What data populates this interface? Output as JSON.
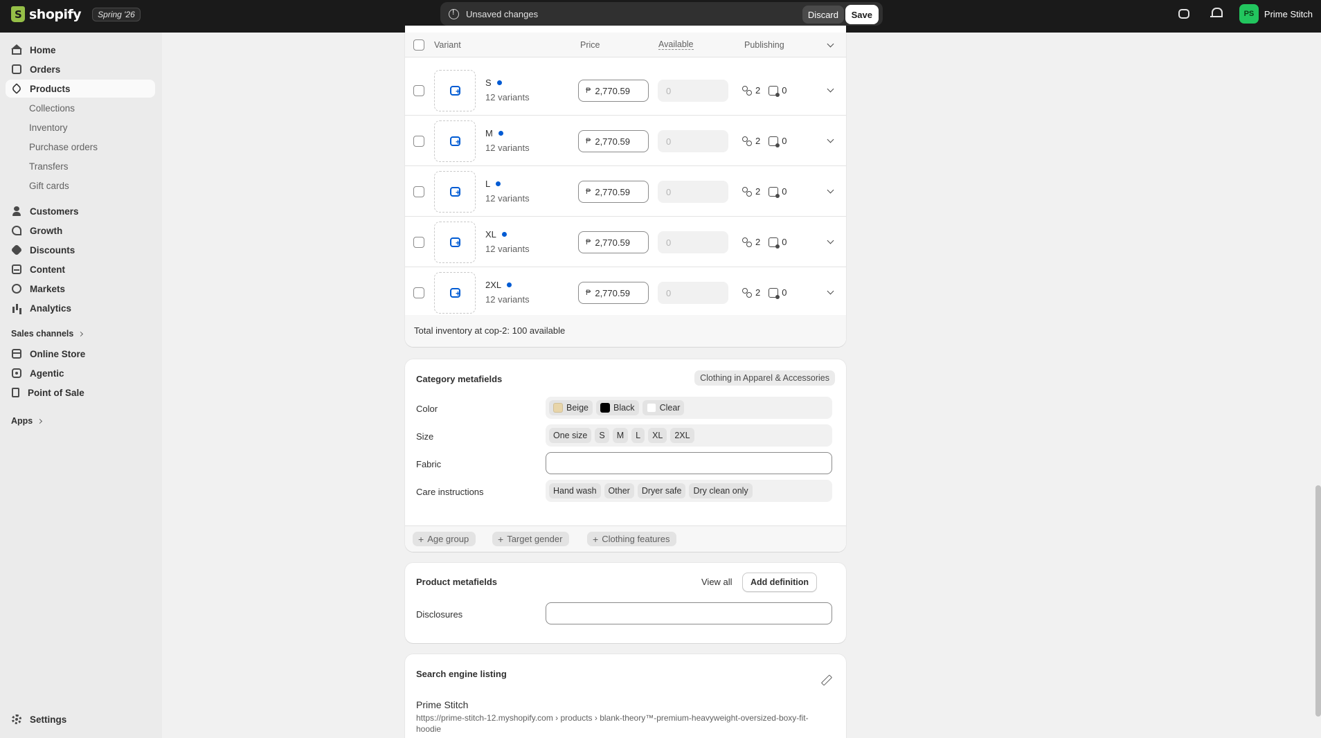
{
  "topbar": {
    "logo_text": "shopify",
    "edition": "Spring '26",
    "unsaved_message": "Unsaved changes",
    "discard_label": "Discard",
    "save_label": "Save",
    "avatar_initials": "PS",
    "store_name": "Prime Stitch"
  },
  "sidebar": {
    "home": "Home",
    "orders": "Orders",
    "products": "Products",
    "products_sub": [
      "Collections",
      "Inventory",
      "Purchase orders",
      "Transfers",
      "Gift cards"
    ],
    "customers": "Customers",
    "growth": "Growth",
    "discounts": "Discounts",
    "content": "Content",
    "markets": "Markets",
    "analytics": "Analytics",
    "sales_channels": "Sales channels",
    "online_store": "Online Store",
    "agentic": "Agentic",
    "point_of_sale": "Point of Sale",
    "apps": "Apps",
    "settings": "Settings"
  },
  "variants": {
    "headers": {
      "variant": "Variant",
      "price": "Price",
      "available": "Available",
      "publishing": "Publishing"
    },
    "currency_symbol": "₱",
    "rows": [
      {
        "name": "S",
        "count": "12 variants",
        "price": "2,770.59",
        "available": "0",
        "channels": "2",
        "markets": "0"
      },
      {
        "name": "M",
        "count": "12 variants",
        "price": "2,770.59",
        "available": "0",
        "channels": "2",
        "markets": "0"
      },
      {
        "name": "L",
        "count": "12 variants",
        "price": "2,770.59",
        "available": "0",
        "channels": "2",
        "markets": "0"
      },
      {
        "name": "XL",
        "count": "12 variants",
        "price": "2,770.59",
        "available": "0",
        "channels": "2",
        "markets": "0"
      },
      {
        "name": "2XL",
        "count": "12 variants",
        "price": "2,770.59",
        "available": "0",
        "channels": "2",
        "markets": "0"
      }
    ],
    "total_inventory": "Total inventory at cop-2: 100 available"
  },
  "category_metafields": {
    "title": "Category metafields",
    "category_badge": "Clothing in Apparel & Accessories",
    "color_label": "Color",
    "colors": [
      {
        "label": "Beige",
        "swatch": "#e8d5a9"
      },
      {
        "label": "Black",
        "swatch": "#000000"
      },
      {
        "label": "Clear",
        "swatch": "#ffffff"
      }
    ],
    "size_label": "Size",
    "sizes": [
      "One size",
      "S",
      "M",
      "L",
      "XL",
      "2XL"
    ],
    "fabric_label": "Fabric",
    "care_label": "Care instructions",
    "care": [
      "Hand wash",
      "Other",
      "Dryer safe",
      "Dry clean only"
    ],
    "add_fields": [
      "Age group",
      "Target gender",
      "Clothing features"
    ]
  },
  "product_metafields": {
    "title": "Product metafields",
    "view_all": "View all",
    "add_definition": "Add definition",
    "disclosures_label": "Disclosures"
  },
  "seo": {
    "title": "Search engine listing",
    "store": "Prime Stitch",
    "url": "https://prime-stitch-12.myshopify.com › products › blank-theory™-premium-heavyweight-oversized-boxy-fit-hoodie"
  },
  "colors": {
    "accent": "#005bd3",
    "topbar": "#1a1a1a",
    "avatar": "#22c55e"
  }
}
